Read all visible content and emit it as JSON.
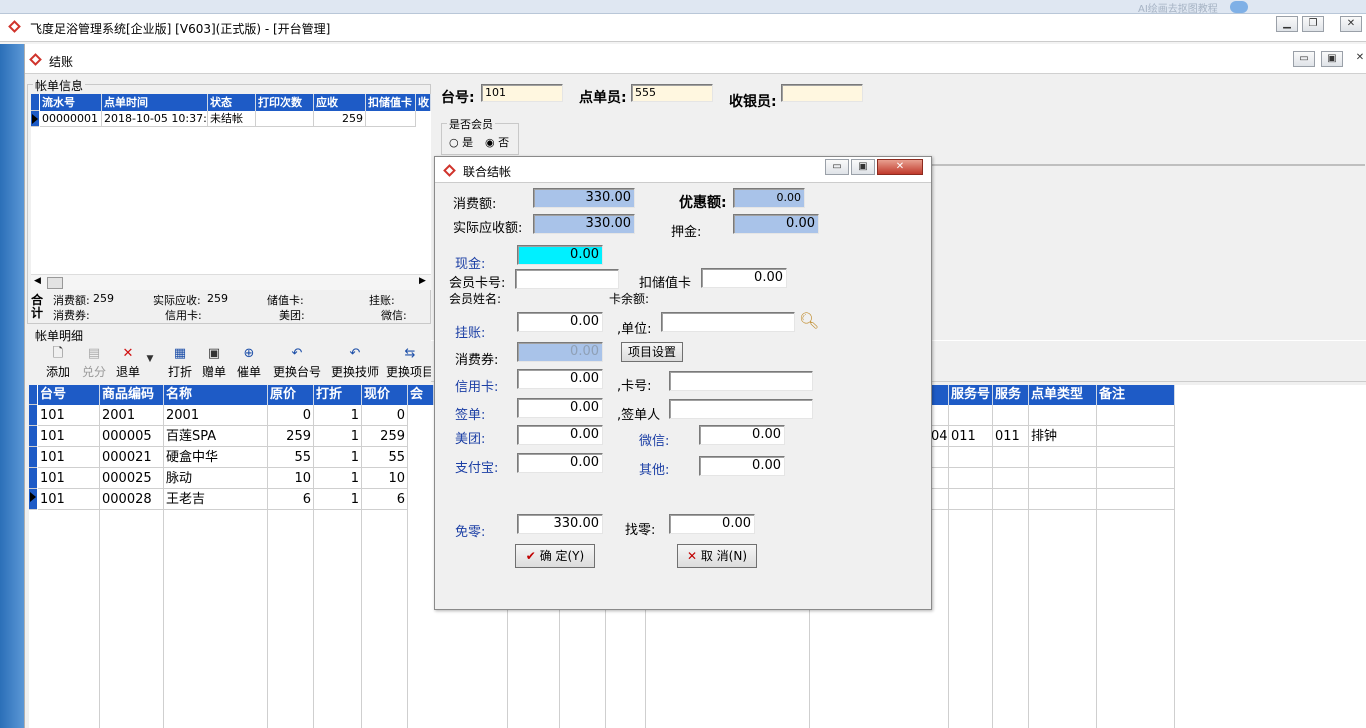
{
  "taskbar": {
    "faded_text": "AI绘画去抠图教程"
  },
  "main_window": {
    "title": "飞度足浴管理系统[企业版] [V603](正式版) - [开台管理]"
  },
  "checkout_window": {
    "title": "结账"
  },
  "bill_info": {
    "group_label": "帐单信息",
    "columns": [
      "流水号",
      "点单时间",
      "状态",
      "打印次数",
      "应收",
      "扣储值卡",
      "收"
    ],
    "rows": [
      {
        "serial": "00000001",
        "time": "2018-10-05 10:37:",
        "status": "未结帐",
        "prints": "",
        "receivable": "259",
        "card": ""
      }
    ]
  },
  "totals": {
    "label": "合计",
    "consume_label": "消费额:",
    "consume_value": "259",
    "actual_label": "实际应收:",
    "actual_value": "259",
    "stored_card_label": "储值卡:",
    "credit_label": "挂账:",
    "voucher_label": "消费券:",
    "creditcard_label": "信用卡:",
    "meituan_label": "美团:",
    "wechat_label": "微信:"
  },
  "header_fields": {
    "table_label": "台号:",
    "table_value": "101",
    "waiter_label": "点单员:",
    "waiter_value": "555",
    "cashier_label": "收银员:",
    "cashier_value": ""
  },
  "member_group": {
    "label": "是否会员",
    "yes": "是",
    "no": "否",
    "selected": "no"
  },
  "detail": {
    "group_label": "帐单明细",
    "toolbar": [
      {
        "name": "add",
        "label": "添加",
        "icon": "document-icon"
      },
      {
        "name": "redeem",
        "label": "兑分",
        "icon": "redeem-icon",
        "disabled": true
      },
      {
        "name": "refund",
        "label": "退单",
        "icon": "red-x-icon"
      },
      {
        "name": "discount",
        "label": "打折",
        "icon": "discount-icon"
      },
      {
        "name": "gift",
        "label": "赠单",
        "icon": "gift-icon"
      },
      {
        "name": "rush",
        "label": "催单",
        "icon": "zoom-icon"
      },
      {
        "name": "change-table",
        "label": "更换台号",
        "icon": "undo-icon"
      },
      {
        "name": "change-tech",
        "label": "更换技师",
        "icon": "undo-icon"
      },
      {
        "name": "change-item",
        "label": "更换项目",
        "icon": "swap-icon"
      }
    ],
    "columns": [
      "台号",
      "商品编码",
      "名称",
      "原价",
      "打折",
      "现价",
      "会"
    ],
    "right_columns": [
      "服务号",
      "服务",
      "点单类型",
      "备注"
    ],
    "rows": [
      {
        "table": "101",
        "code": "2001",
        "name": "2001",
        "price": "0",
        "discount": "1",
        "now": "0",
        "r1": "",
        "r2": "",
        "r3": "",
        "r4": "",
        "r0": ""
      },
      {
        "table": "101",
        "code": "000005",
        "name": "百莲SPA",
        "price": "259",
        "discount": "1",
        "now": "259",
        "r0": "04:",
        "r1": "011",
        "r2": "011",
        "r3": "排钟",
        "r4": ""
      },
      {
        "table": "101",
        "code": "000021",
        "name": "硬盒中华",
        "price": "55",
        "discount": "1",
        "now": "55",
        "r0": "",
        "r1": "",
        "r2": "",
        "r3": "",
        "r4": ""
      },
      {
        "table": "101",
        "code": "000025",
        "name": "脉动",
        "price": "10",
        "discount": "1",
        "now": "10",
        "r0": "",
        "r1": "",
        "r2": "",
        "r3": "",
        "r4": ""
      },
      {
        "table": "101",
        "code": "000028",
        "name": "王老吉",
        "price": "6",
        "discount": "1",
        "now": "6",
        "r0": "",
        "r1": "",
        "r2": "",
        "r3": "",
        "r4": ""
      }
    ]
  },
  "combined": {
    "title": "联合结帐",
    "consume_label": "消费额:",
    "consume_value": "330.00",
    "discount_label": "优惠额:",
    "discount_value": "0.00",
    "actual_label": "实际应收额:",
    "actual_value": "330.00",
    "deposit_label": "押金:",
    "deposit_value": "0.00",
    "cash_label": "现金:",
    "cash_value": "0.00",
    "member_card_label": "会员卡号:",
    "member_card_value": "",
    "stored_card_label": "扣储值卡",
    "stored_card_value": "0.00",
    "member_name_label": "会员姓名:",
    "card_balance_label": "卡余额:",
    "credit_label": "挂账:",
    "credit_value": "0.00",
    "unit_label": ",单位:",
    "unit_value": "",
    "voucher_label": "消费券:",
    "voucher_value": "0.00",
    "item_settings_label": "项目设置",
    "creditcard_label": "信用卡:",
    "creditcard_value": "0.00",
    "cardno_label": ",卡号:",
    "cardno_value": "",
    "sign_label": "签单:",
    "sign_value": "0.00",
    "signer_label": ",签单人",
    "signer_value": "",
    "meituan_label": "美团:",
    "meituan_value": "0.00",
    "wechat_label": "微信:",
    "wechat_value": "0.00",
    "alipay_label": "支付宝:",
    "alipay_value": "0.00",
    "other_label": "其他:",
    "other_value": "0.00",
    "waive_label": "免零:",
    "waive_value": "330.00",
    "change_label": "找零:",
    "change_value": "0.00",
    "ok_label": "确 定(Y)",
    "cancel_label": "取 消(N)"
  },
  "colors": {
    "header_blue": "#1e5bc6",
    "field_blue": "#a9c3e9",
    "cash_cyan": "#00f0ff",
    "label_blue": "#1c3fa5"
  }
}
